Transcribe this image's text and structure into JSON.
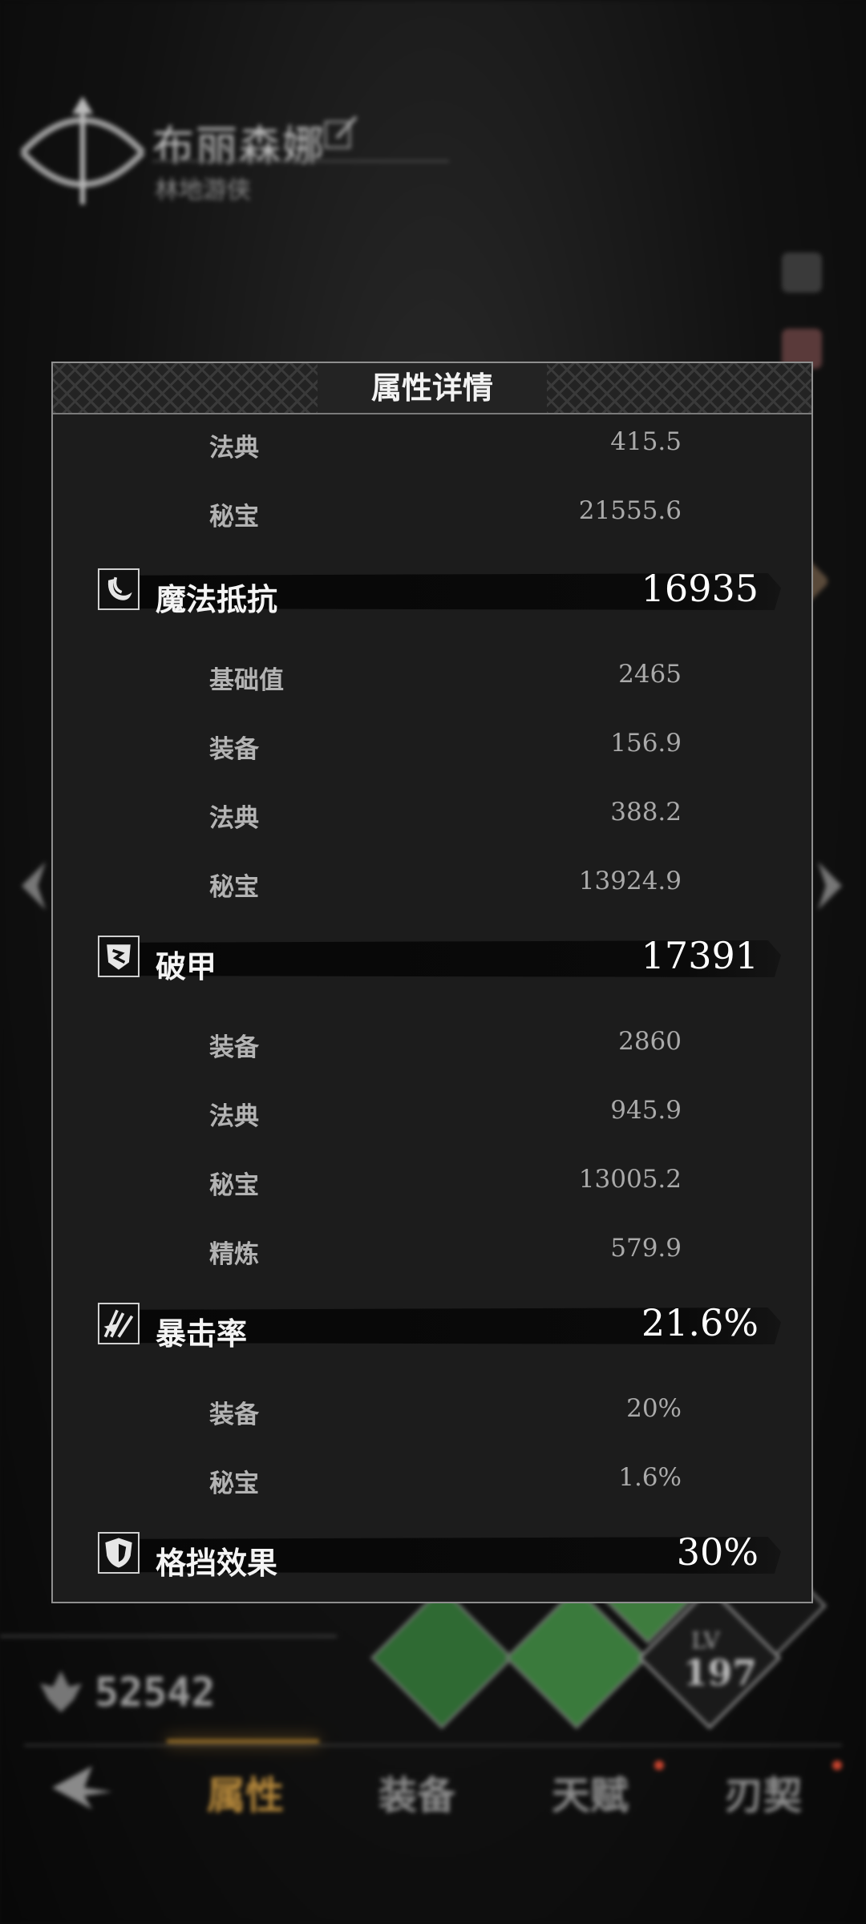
{
  "character": {
    "name": "布丽森娜",
    "subtitle": "林地游侠"
  },
  "power": {
    "value": "52542"
  },
  "level": {
    "label": "LV",
    "value": "197"
  },
  "bottom_nav": {
    "tabs": [
      {
        "label": "属性",
        "active": true
      },
      {
        "label": "装备",
        "active": false
      },
      {
        "label": "天赋",
        "active": false
      },
      {
        "label": "刃契",
        "active": false
      }
    ]
  },
  "dialog": {
    "title": "属性详情",
    "top_rows": [
      {
        "label": "法典",
        "value": "415.5"
      },
      {
        "label": "秘宝",
        "value": "21555.6"
      }
    ],
    "sections": [
      {
        "icon": "magic-resist-icon",
        "label": "魔法抵抗",
        "value": "16935",
        "rows": [
          {
            "label": "基础值",
            "value": "2465"
          },
          {
            "label": "装备",
            "value": "156.9"
          },
          {
            "label": "法典",
            "value": "388.2"
          },
          {
            "label": "秘宝",
            "value": "13924.9"
          }
        ]
      },
      {
        "icon": "armor-break-icon",
        "label": "破甲",
        "value": "17391",
        "rows": [
          {
            "label": "装备",
            "value": "2860"
          },
          {
            "label": "法典",
            "value": "945.9"
          },
          {
            "label": "秘宝",
            "value": "13005.2"
          },
          {
            "label": "精炼",
            "value": "579.9"
          }
        ]
      },
      {
        "icon": "crit-rate-icon",
        "label": "暴击率",
        "value": "21.6%",
        "rows": [
          {
            "label": "装备",
            "value": "20%"
          },
          {
            "label": "秘宝",
            "value": "1.6%"
          }
        ]
      },
      {
        "icon": "block-effect-icon",
        "label": "格挡效果",
        "value": "30%",
        "rows": []
      }
    ]
  },
  "colors": {
    "accent_gold": "#b7893b",
    "dialog_bg": "#1c1c1c",
    "border": "#8f8f8f"
  }
}
